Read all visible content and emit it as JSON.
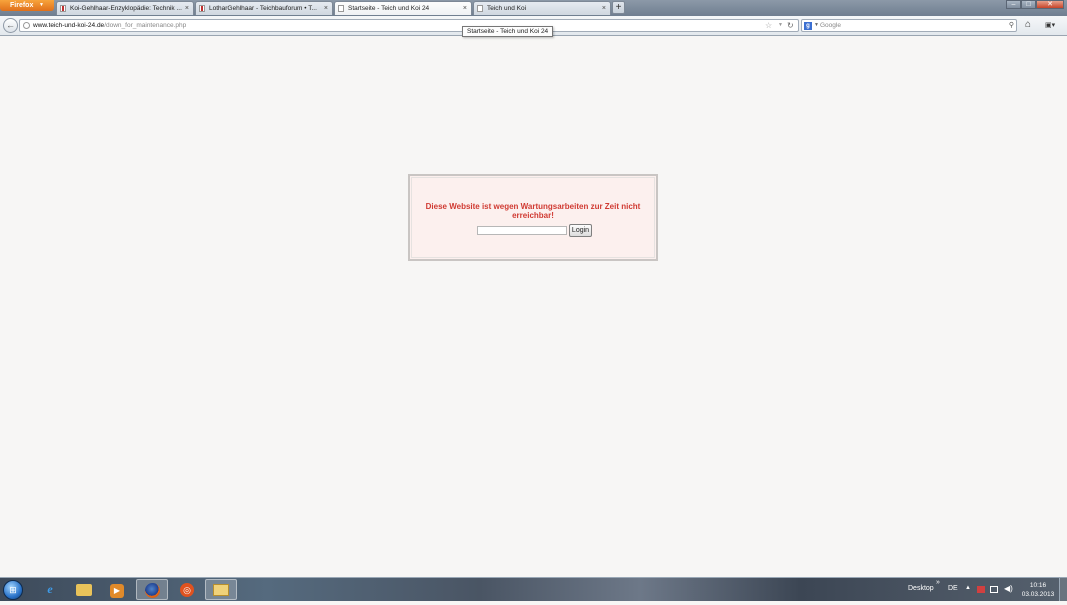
{
  "browser": {
    "menu_label": "Firefox",
    "tabs": [
      {
        "label": "Koi-Gehlhaar-Enzyklopädie: Technik ..."
      },
      {
        "label": "LotharGehlhaar - Teichbauforum • T..."
      },
      {
        "label": "Startseite - Teich und Koi 24"
      },
      {
        "label": "Teich und Koi"
      }
    ],
    "new_tab_label": "+",
    "tab_close_glyph": "×",
    "url_domain": "www.teich-und-koi-24.de",
    "url_path": "/down_for_maintenance.php",
    "search_placeholder": "Google",
    "tooltip": "Startseite - Teich und Koi 24"
  },
  "page": {
    "message": "Diese Website ist wegen Wartungsarbeiten zur Zeit nicht erreichbar!",
    "login_value": "",
    "login_button": "Login",
    "message_color": "#d03a32"
  },
  "taskbar": {
    "desktop_label": "Desktop",
    "chevron": "»",
    "language": "DE",
    "time": "10:16",
    "date": "03.03.2013"
  },
  "icons": {
    "start": "windows-start-icon",
    "ie": "internet-explorer-icon",
    "folder": "file-explorer-icon",
    "media": "media-player-icon",
    "firefox": "firefox-icon",
    "ubuntu": "ubuntu-icon",
    "explorer": "explorer-window-icon"
  }
}
